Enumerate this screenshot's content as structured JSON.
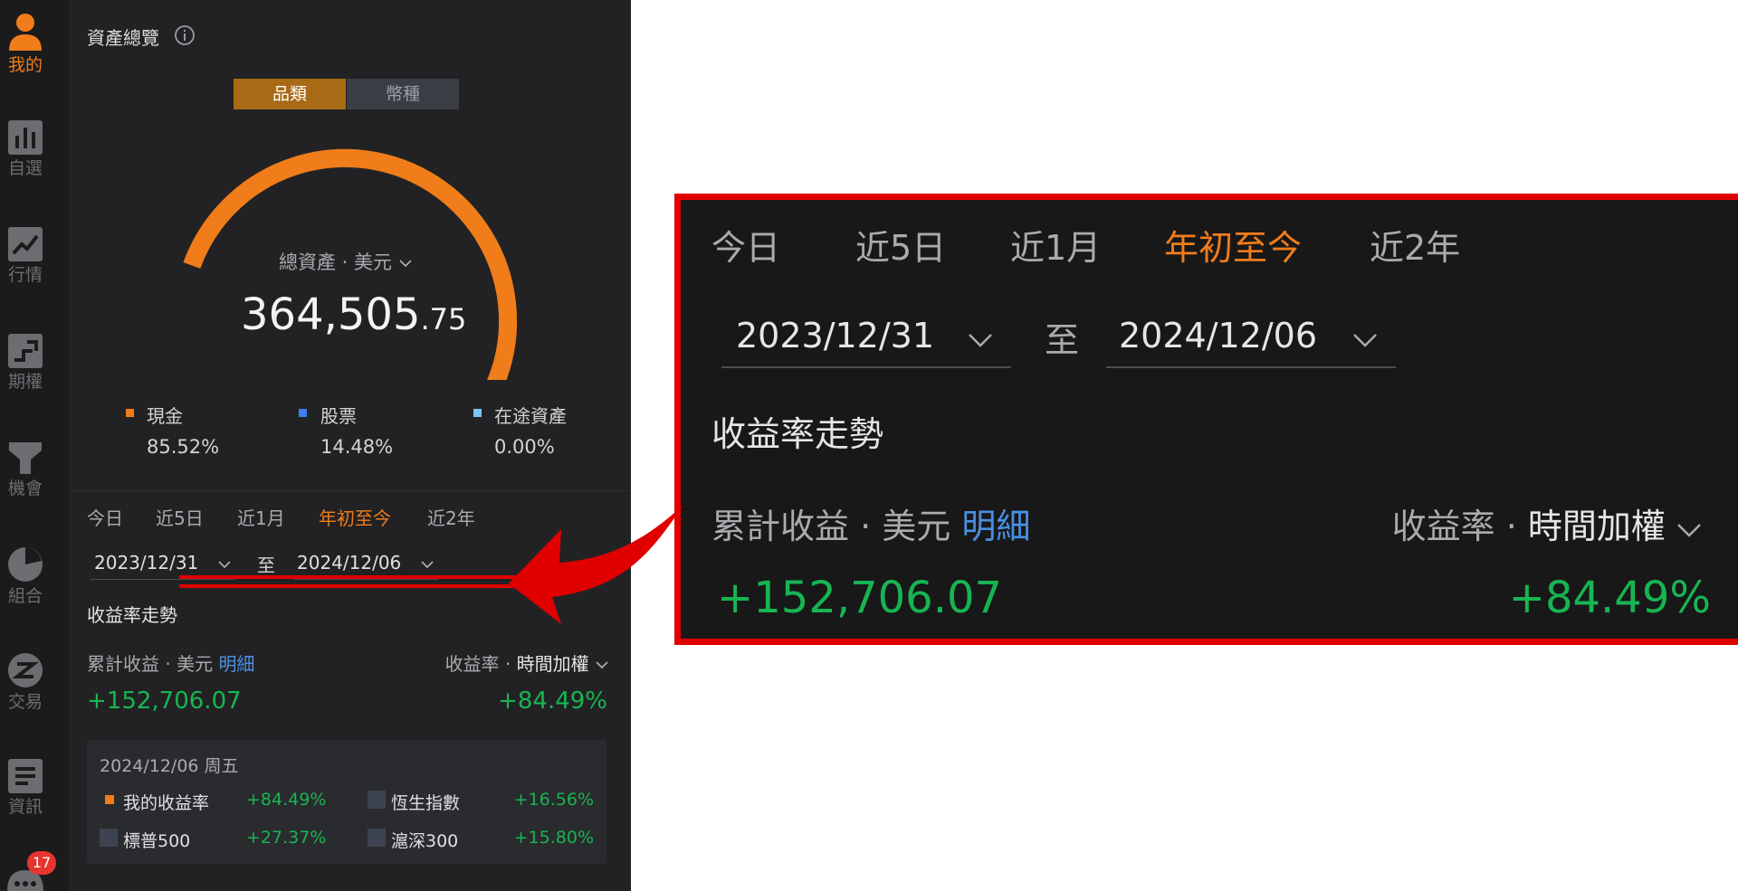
{
  "sidebar": {
    "items": [
      {
        "label": "我的",
        "icon": "person-icon",
        "active": true
      },
      {
        "label": "自選",
        "icon": "bar-chart-icon"
      },
      {
        "label": "行情",
        "icon": "trend-chart-icon"
      },
      {
        "label": "期權",
        "icon": "options-icon"
      },
      {
        "label": "機會",
        "icon": "funnel-icon"
      },
      {
        "label": "組合",
        "icon": "pie-chart-icon"
      },
      {
        "label": "交易",
        "icon": "trade-icon"
      },
      {
        "label": "資訊",
        "icon": "news-icon"
      }
    ],
    "chat_badge": "17"
  },
  "overview": {
    "title": "資產總覽",
    "toggle": {
      "active": "品類",
      "inactive": "幣種"
    },
    "total_label": "總資產 · 美元",
    "total_int": "364,505",
    "total_dec": ".75",
    "gauge": {
      "cash_fraction": 0.8552,
      "stock_fraction": 0.1448
    },
    "legend": [
      {
        "label": "現金",
        "value": "85.52%",
        "color": "#f07d1a"
      },
      {
        "label": "股票",
        "value": "14.48%",
        "color": "#3b7ff0"
      },
      {
        "label": "在途資產",
        "value": "0.00%",
        "color": "#7cc4f5"
      }
    ]
  },
  "tabs": [
    "今日",
    "近5日",
    "近1月",
    "年初至今",
    "近2年"
  ],
  "active_tab": "年初至今",
  "date_range": {
    "start": "2023/12/31",
    "separator": "至",
    "end": "2024/12/06"
  },
  "trend_title": "收益率走勢",
  "cumulative": {
    "label": "累計收益 · 美元",
    "detail_link": "明細",
    "value": "+152,706.07",
    "rate_label": "收益率 · ",
    "rate_mode": "時間加權",
    "rate_value": "+84.49%"
  },
  "tooltip": {
    "date": "2024/12/06 周五",
    "rows": [
      {
        "name": "我的收益率",
        "value": "+84.49%"
      },
      {
        "name": "恆生指數",
        "value": "+16.56%"
      },
      {
        "name": "標普500",
        "value": "+27.37%"
      },
      {
        "name": "滬深300",
        "value": "+15.80%"
      }
    ]
  },
  "colors": {
    "accent": "#f07d1a",
    "positive": "#17b552",
    "link": "#4a90e2",
    "callout": "#e00000"
  }
}
